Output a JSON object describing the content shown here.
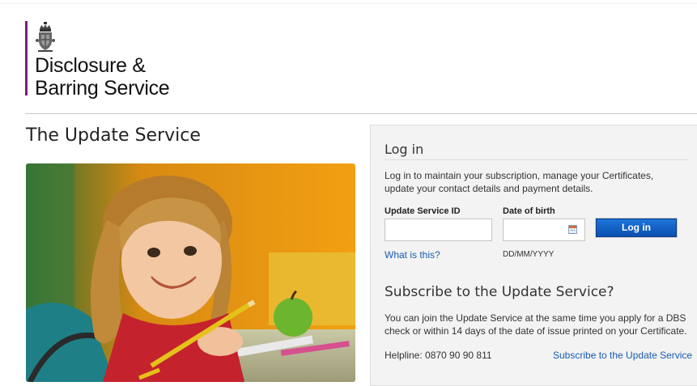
{
  "header": {
    "logo_line1": "Disclosure &",
    "logo_line2": "Barring Service",
    "accent_color": "#7a1f7a"
  },
  "main": {
    "title": "The Update Service",
    "hero_alt": "smiling girl"
  },
  "login": {
    "title": "Log in",
    "description": "Log in to maintain your subscription, manage your Certificates, update your contact details and payment details.",
    "service_id_label": "Update Service ID",
    "service_id_value": "",
    "dob_label": "Date of birth",
    "dob_value": "",
    "button_label": "Log in",
    "what_is_this": "What is this?",
    "dob_format": "DD/MM/YYYY",
    "button_color": "#1565c8"
  },
  "subscribe": {
    "title": "Subscribe to the Update Service?",
    "description": "You can join the Update Service at the same time you apply for a DBS check or within 14 days of the date of issue printed on your Certificate.",
    "helpline": "Helpline: 0870 90 90 811",
    "link": "Subscribe to the Update Service"
  },
  "icons": {
    "crest": "crown-crest-icon",
    "calendar": "calendar-icon"
  }
}
